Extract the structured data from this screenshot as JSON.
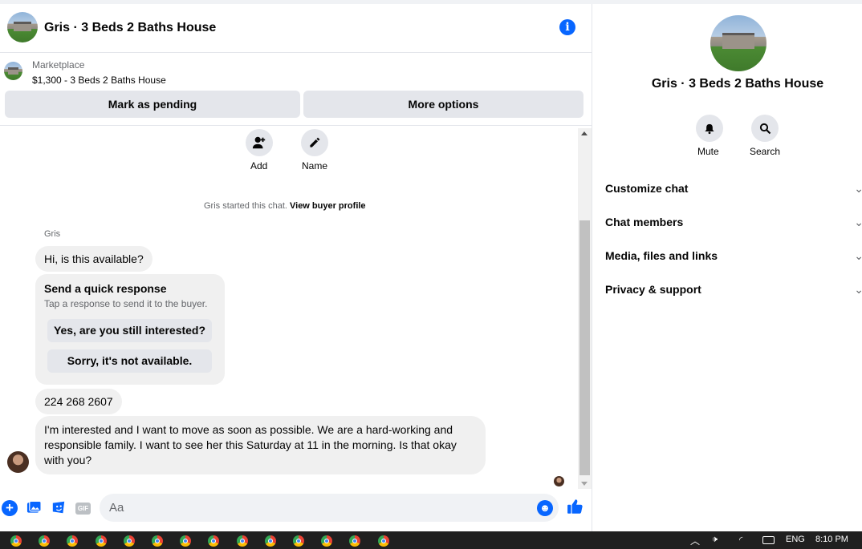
{
  "header": {
    "title": "Gris · 3 Beds 2 Baths House"
  },
  "listing": {
    "category": "Marketplace",
    "price_title": "$1,300 - 3 Beds 2 Baths House",
    "mark_pending_label": "Mark as pending",
    "more_options_label": "More options"
  },
  "chat": {
    "add_label": "Add",
    "name_label": "Name",
    "started_text": "Gris started this chat.",
    "view_buyer_profile": "View buyer profile",
    "sender_name": "Gris",
    "message_1": "Hi, is this available?",
    "quick_response_title": "Send a quick response",
    "quick_response_subtitle": "Tap a response to send it to the buyer.",
    "quick_response_options": [
      "Yes, are you still interested?",
      "Sorry, it's not available."
    ],
    "message_2": "224 268 2607",
    "message_3": "I'm interested and I want to move as soon as possible. We are a hard-working and responsible family. I want to see her this Saturday at 11 in the morning. Is that okay with you?"
  },
  "composer": {
    "placeholder": "Aa",
    "gif_label": "GIF"
  },
  "details_panel": {
    "title": "Gris · 3 Beds 2 Baths House",
    "actions": [
      {
        "label": "Mute",
        "icon": "bell-icon"
      },
      {
        "label": "Search",
        "icon": "search-icon"
      }
    ],
    "sections": [
      "Customize chat",
      "Chat members",
      "Media, files and links",
      "Privacy & support"
    ]
  },
  "taskbar": {
    "app_count": 14,
    "language": "ENG",
    "time": "8:10 PM"
  },
  "colors": {
    "accent": "#0866ff",
    "bubble": "#f0f0f0",
    "button": "#e4e6eb",
    "taskbar": "#202020"
  }
}
